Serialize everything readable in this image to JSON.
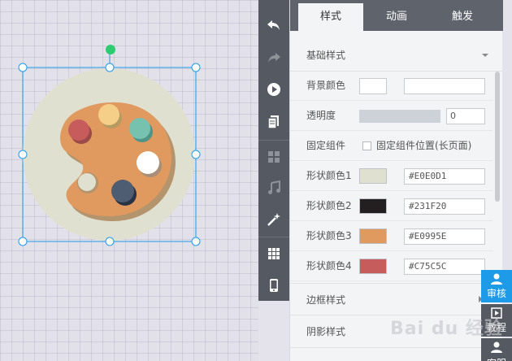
{
  "tabs": [
    {
      "label": "样式",
      "active": true
    },
    {
      "label": "动画",
      "active": false
    },
    {
      "label": "触发",
      "active": false
    }
  ],
  "basic_section": {
    "title": "基础样式"
  },
  "fields": {
    "bg_color_label": "背景颜色",
    "opacity_label": "透明度",
    "opacity_value": "0",
    "fixed_label": "固定组件",
    "fixed_checkbox_label": "固定组件位置(长页面)"
  },
  "shape_colors": [
    {
      "label": "形状颜色1",
      "hex": "#E0E0D1",
      "color": "#E0E0D1"
    },
    {
      "label": "形状颜色2",
      "hex": "#231F20",
      "color": "#231F20"
    },
    {
      "label": "形状颜色3",
      "hex": "#E0995E",
      "color": "#E0995E"
    },
    {
      "label": "形状颜色4",
      "hex": "#C75C5C",
      "color": "#C75C5C"
    }
  ],
  "border_section": {
    "title": "边框样式"
  },
  "shadow_section": {
    "title": "阴影样式"
  },
  "side_buttons": {
    "review": "审核",
    "tutorial": "教程",
    "service": "客服"
  },
  "toolbar_icons": [
    "undo-icon",
    "redo-icon",
    "play-icon",
    "pages-icon",
    "grid-icon",
    "music-icon",
    "magic-icon",
    "table-icon",
    "phone-icon"
  ],
  "colors": {
    "accent_blue": "#1e9be8",
    "handle_green": "#2ecc71",
    "toolbar_bg": "#555a62",
    "tab_bg": "#5f646c"
  },
  "watermark": "Bai du 经验"
}
